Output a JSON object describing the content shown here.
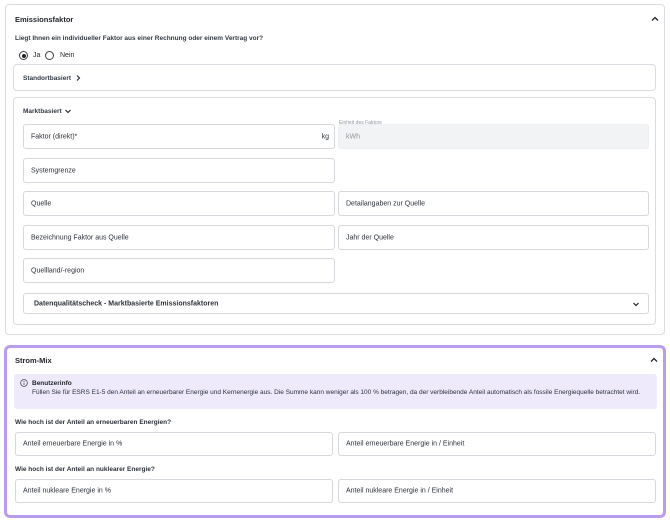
{
  "emission": {
    "title": "Emissionsfaktor",
    "question": "Liegt Ihnen ein individueller Faktor aus einer Rechnung oder einem Vertrag vor?",
    "radio_yes": "Ja",
    "radio_no": "Nein",
    "standort_label": "Standortbasiert",
    "markt_label": "Marktbasiert",
    "fields": {
      "faktor": "Faktor (direkt)*",
      "faktor_unit": "kg",
      "einheit_float": "Einheit des Faktors",
      "einheit_value": "kWh",
      "systemgrenze": "Systemgrenze",
      "quelle": "Quelle",
      "detailangaben": "Detailangaben zur Quelle",
      "bezeichnung": "Bezeichnung Faktor aus Quelle",
      "jahr": "Jahr der Quelle",
      "quellland": "Quellland/-region"
    },
    "dqc_label": "Datenqualitätscheck - Marktbasierte Emissionsfaktoren"
  },
  "strom": {
    "title": "Strom-Mix",
    "info_title": "Benutzerinfo",
    "info_text": "Füllen Sie für ESRS E1-5 den Anteil an erneuerbarer Energie und Kernenergie aus. Die Summe kann weniger als 100 % betragen, da der verbleibende Anteil automatisch als fossile Energiequelle betrachtet wird.",
    "q_renewable": "Wie hoch ist der Anteil an erneuerbaren Energien?",
    "renew_percent": "Anteil erneuerbare Energie in %",
    "renew_unit": "Anteil erneuerbare Energie in / Einheit",
    "q_nuclear": "Wie hoch ist der Anteil an nuklearer Energie?",
    "nuclear_percent": "Anteil nukleare Energie in %",
    "nuclear_unit": "Anteil nukleare Energie in / Einheit"
  },
  "colors": {
    "accent_border": "#b79cf0",
    "info_bg": "#eeeafc"
  },
  "icons": {
    "collapse": "chevron-up-icon",
    "expand": "chevron-down-icon",
    "right": "chevron-right-icon",
    "info": "info-circle-icon"
  }
}
